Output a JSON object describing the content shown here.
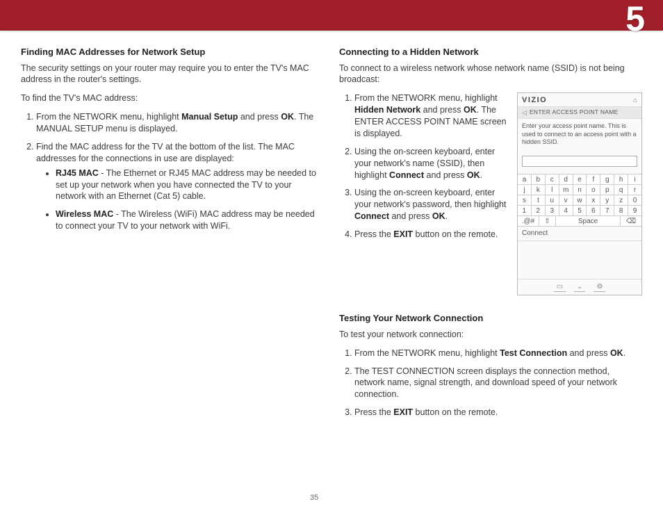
{
  "chapterNumber": "5",
  "pageNumber": "35",
  "left": {
    "heading": "Finding MAC Addresses for Network Setup",
    "p1": "The security settings on your router may require you to enter the TV's MAC address in the router's settings.",
    "p2": "To find the TV's MAC address:",
    "steps": [
      {
        "pre": "From the NETWORK menu, highlight ",
        "b1": "Manual Setup",
        "mid": " and press ",
        "b2": "OK",
        "post": ". The MANUAL SETUP menu is displayed."
      },
      {
        "text": "Find the MAC address for the TV at the bottom of the list. The MAC addresses for the connections in use are displayed:"
      }
    ],
    "bullets": [
      {
        "b": "RJ45 MAC",
        "text": " - The Ethernet or RJ45 MAC address may be needed to set up your network when you have connected the TV to your network with an Ethernet (Cat 5) cable."
      },
      {
        "b": "Wireless MAC",
        "text": " - The Wireless (WiFi) MAC address may be needed to connect your TV to your network with WiFi."
      }
    ]
  },
  "rightTop": {
    "heading": "Connecting to a Hidden Network",
    "p1": "To connect to a wireless network whose network name (SSID) is not being broadcast:",
    "steps": [
      {
        "pre": "From the NETWORK menu, highlight ",
        "b1": "Hidden Network",
        "mid": " and press ",
        "b2": "OK",
        "post": ". The ENTER ACCESS POINT NAME screen is displayed."
      },
      {
        "pre": "Using the on-screen keyboard, enter your network's name (SSID), then highlight ",
        "b1": "Connect",
        "mid": " and press ",
        "b2": "OK",
        "post": "."
      },
      {
        "pre": "Using the on-screen keyboard, enter your network's password, then highlight ",
        "b1": "Connect",
        "mid": " and press ",
        "b2": "OK",
        "post": "."
      },
      {
        "pre": "Press the ",
        "b1": "EXIT",
        "post": " button on the remote."
      }
    ]
  },
  "uiPanel": {
    "brand": "VIZIO",
    "subtitle": "ENTER ACCESS POINT NAME",
    "help": "Enter your access point name. This is used to connect to an access point with a hidden SSID.",
    "rows": [
      [
        "a",
        "b",
        "c",
        "d",
        "e",
        "f",
        "g",
        "h",
        "i"
      ],
      [
        "j",
        "k",
        "l",
        "m",
        "n",
        "o",
        "p",
        "q",
        "r"
      ],
      [
        "s",
        "t",
        "u",
        "v",
        "w",
        "x",
        "y",
        "z",
        "0"
      ],
      [
        "1",
        "2",
        "3",
        "4",
        "5",
        "6",
        "7",
        "8",
        "9"
      ]
    ],
    "sym": ".@#",
    "shift": "⇧",
    "space": "Space",
    "back": "⌫",
    "connect": "Connect",
    "footerIcons": [
      "▭",
      "⌄",
      "⚙"
    ]
  },
  "testing": {
    "heading": "Testing Your Network Connection",
    "p1": "To test your network connection:",
    "steps": [
      {
        "pre": "From the NETWORK menu, highlight ",
        "b1": "Test Connection",
        "mid": " and press ",
        "b2": "OK",
        "post": "."
      },
      {
        "text": "The TEST CONNECTION screen displays the connection method, network name, signal strength, and download speed of your network connection."
      },
      {
        "pre": "Press the ",
        "b1": "EXIT",
        "post": " button on the remote."
      }
    ]
  }
}
